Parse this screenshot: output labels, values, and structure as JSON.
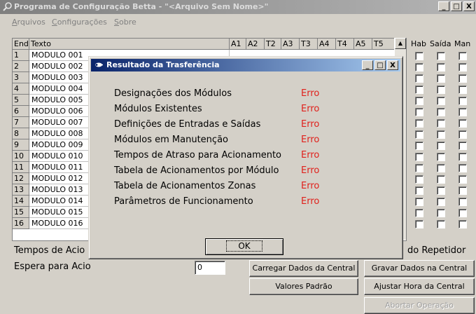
{
  "window": {
    "title": "Programa de Configuração Betta - \"<Arquivo Sem Nome>\"",
    "minimize": "_",
    "maximize": "□",
    "close": "X"
  },
  "menu": [
    "Arquivos",
    "Configurações",
    "Sobre"
  ],
  "grid": {
    "headers": [
      "End",
      "Texto",
      "A1",
      "A2",
      "T2",
      "A3",
      "T3",
      "A4",
      "T4",
      "A5",
      "T5"
    ],
    "rows": [
      {
        "num": "1",
        "text": "MODULO 001"
      },
      {
        "num": "2",
        "text": "MODULO 002"
      },
      {
        "num": "3",
        "text": "MODULO 003"
      },
      {
        "num": "4",
        "text": "MODULO 004"
      },
      {
        "num": "5",
        "text": "MODULO 005"
      },
      {
        "num": "6",
        "text": "MODULO 006"
      },
      {
        "num": "7",
        "text": "MODULO 007"
      },
      {
        "num": "8",
        "text": "MODULO 008"
      },
      {
        "num": "9",
        "text": "MODULO 009"
      },
      {
        "num": "10",
        "text": "MODULO 010"
      },
      {
        "num": "11",
        "text": "MODULO 011"
      },
      {
        "num": "12",
        "text": "MODULO 012"
      },
      {
        "num": "13",
        "text": "MODULO 013"
      },
      {
        "num": "14",
        "text": "MODULO 014"
      },
      {
        "num": "15",
        "text": "MODULO 015"
      },
      {
        "num": "16",
        "text": "MODULO 016"
      }
    ]
  },
  "checkbox_headers": [
    "Hab",
    "Saída",
    "Man"
  ],
  "labels": {
    "tempos": "Tempos de Acio",
    "espera": "Espera para Acio",
    "repetidor": "do Repetidor",
    "espera_value": "0"
  },
  "buttons": {
    "carregar": "Carregar Dados da Central",
    "gravar": "Gravar Dados na Central",
    "valores": "Valores Padrão",
    "ajustar": "Ajustar Hora da Central",
    "abortar": "Abortar Operação"
  },
  "dialog": {
    "title": "Resultado da Trasferência",
    "minimize": "_",
    "maximize": "□",
    "close": "X",
    "items": [
      {
        "label": "Designações dos Módulos",
        "status": "Erro"
      },
      {
        "label": "Módulos Existentes",
        "status": "Erro"
      },
      {
        "label": "Definições de Entradas e Saídas",
        "status": "Erro"
      },
      {
        "label": "Módulos em Manutenção",
        "status": "Erro"
      },
      {
        "label": "Tempos de Atraso para Acionamento",
        "status": "Erro"
      },
      {
        "label": "Tabela de Acionamentos por Módulo",
        "status": "Erro"
      },
      {
        "label": "Tabela de Acionamentos Zonas",
        "status": "Erro"
      },
      {
        "label": "Parâmetros de Funcionamento",
        "status": "Erro"
      }
    ],
    "ok": "OK"
  },
  "colors": {
    "error": "#e0201b",
    "dialog_title": "#0a246a"
  },
  "icons": {
    "app": "magnifier-icon",
    "dialog": "transfer-icon"
  }
}
